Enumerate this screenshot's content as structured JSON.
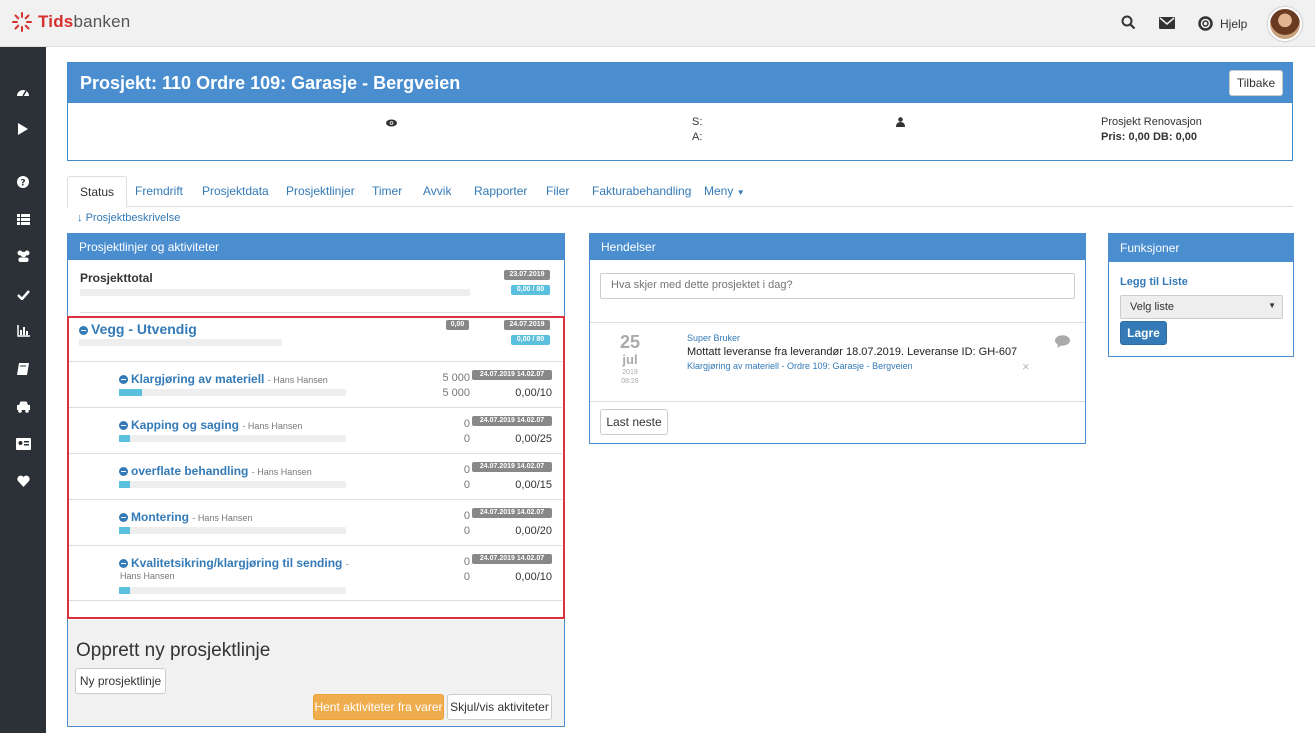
{
  "brand": {
    "logo_part1": "Tids",
    "logo_part2": "banken"
  },
  "topbar": {
    "help_label": "Hjelp"
  },
  "project": {
    "title": "Prosjekt: 110 Ordre 109: Garasje - Bergveien",
    "back_label": "Tilbake",
    "s_label": "S:",
    "a_label": "A:",
    "customer": "Prosjekt Renovasjon",
    "price": "Pris: 0,00 DB: 0,00"
  },
  "tabs": [
    "Status",
    "Fremdrift",
    "Prosjektdata",
    "Prosjektlinjer",
    "Timer",
    "Avvik",
    "Rapporter",
    "Filer",
    "Fakturabehandling",
    "Meny"
  ],
  "description_link": "Prosjektbeskrivelse",
  "lines_panel": {
    "title": "Prosjektlinjer og aktiviteter",
    "total_label": "Prosjekttotal",
    "total_date": "23.07.2019",
    "total_hours": "0,00 / 80",
    "group_title": "Vegg - Utvendig",
    "group_value": "0,00",
    "group_date": "24.07.2019",
    "group_hours": "0,00 / 80",
    "activities": [
      {
        "name": "Klargjøring av materiell",
        "person": "- Hans Hansen",
        "val1": "5 000",
        "val2": "5 000",
        "dates": "24.07.2019 14.02.07",
        "hours": "0,00/10",
        "progress": 0.1
      },
      {
        "name": "Kapping og saging",
        "person": "- Hans Hansen",
        "val1": "0",
        "val2": "0",
        "dates": "24.07.2019 14.02.07",
        "hours": "0,00/25",
        "progress": 0.1
      },
      {
        "name": "overflate behandling",
        "person": "- Hans Hansen",
        "val1": "0",
        "val2": "0",
        "dates": "24.07.2019 14.02.07",
        "hours": "0,00/15",
        "progress": 0.1
      },
      {
        "name": "Montering",
        "person": "- Hans Hansen",
        "val1": "0",
        "val2": "0",
        "dates": "24.07.2019 14.02.07",
        "hours": "0,00/20",
        "progress": 0.1
      },
      {
        "name": "Kvalitetsikring/klargjøring til sending",
        "person": "-",
        "person2": "Hans Hansen",
        "val1": "0",
        "val2": "0",
        "dates": "24.07.2019 14.02.07",
        "hours": "0,00/10",
        "progress": 0.1
      }
    ],
    "create_heading": "Opprett ny prosjektlinje",
    "new_line_btn": "Ny prosjektlinje",
    "fetch_btn": "Hent aktiviteter fra varer",
    "toggle_btn": "Skjul/vis aktiviteter"
  },
  "events_panel": {
    "title": "Hendelser",
    "input_placeholder": "Hva skjer med dette prosjektet i dag?",
    "event": {
      "day": "25",
      "month": "jul",
      "year": "2019",
      "time": "08:28",
      "author": "Super Bruker",
      "message": "Mottatt leveranse fra leverandør 18.07.2019. Leveranse ID: GH-607",
      "context": "Klargjøring av materiell - Ordre 109: Garasje - Bergveien",
      "close": "×"
    },
    "load_next": "Last neste"
  },
  "functions_panel": {
    "title": "Funksjoner",
    "add_list": "Legg til Liste",
    "select_value": "Velg liste",
    "save": "Lagre"
  },
  "colors": {
    "primary": "#4a8ed0",
    "sidebar": "#2c3138",
    "highlight": "#d9323a",
    "warning": "#f0ad4e",
    "info": "#5bc0de"
  }
}
